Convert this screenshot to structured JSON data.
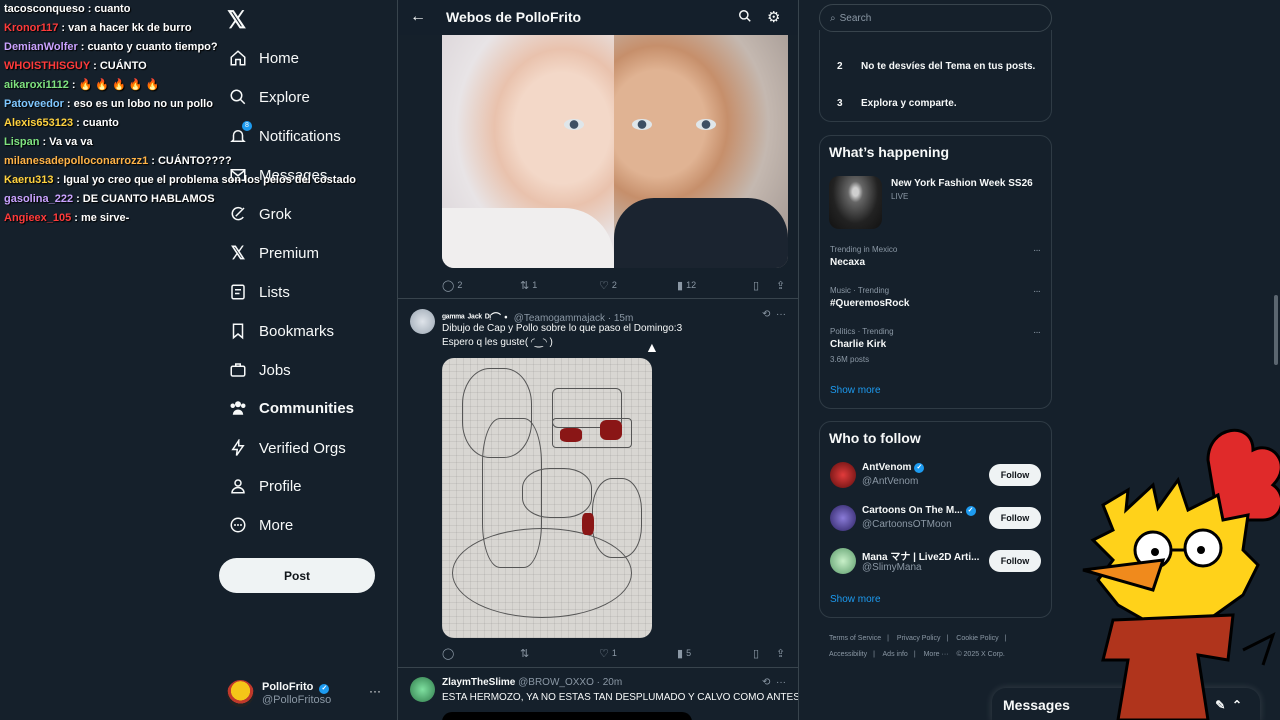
{
  "chat": {
    "messages": [
      {
        "user": "tacosconqueso",
        "color": "#ffffff",
        "text": "cuanto"
      },
      {
        "user": "Kronor117",
        "color": "#ff3b3b",
        "text": "van a hacer kk de burro"
      },
      {
        "user": "DemianWolfer",
        "color": "#c9a2ff",
        "text": "cuanto y cuanto tiempo?"
      },
      {
        "user": "WHOISTHISGUY",
        "color": "#ff3b3b",
        "text": "CUÁNTO"
      },
      {
        "user": "aikaroxi1112",
        "color": "#7fe37f",
        "text": "🔥 🔥 🔥 🔥 🔥"
      },
      {
        "user": "Patoveedor",
        "color": "#7fc7ff",
        "text": "eso es un lobo no un pollo"
      },
      {
        "user": "Alexis653123",
        "color": "#ffd23f",
        "text": "cuanto"
      },
      {
        "user": "Lispan",
        "color": "#7fe37f",
        "text": "Va va va"
      },
      {
        "user": "milanesadepolloconarrozz1",
        "color": "#ffb347",
        "text": "CUÁNTO????"
      },
      {
        "user": "Kaeru313",
        "color": "#ffd23f",
        "text": "Igual yo creo que el problema son los pelos del costado"
      },
      {
        "user": "gasolina_222",
        "color": "#c9a2ff",
        "text": "DE CUANTO HABLAMOS"
      },
      {
        "user": "Angieex_105",
        "color": "#ff3b3b",
        "text": "me sirve-"
      }
    ]
  },
  "nav": {
    "items": [
      {
        "label": "Home",
        "icon": "home-icon"
      },
      {
        "label": "Explore",
        "icon": "search-icon"
      },
      {
        "label": "Notifications",
        "icon": "bell-icon"
      },
      {
        "label": "Messages",
        "icon": "mail-icon"
      },
      {
        "label": "Grok",
        "icon": "grok-icon"
      },
      {
        "label": "Premium",
        "icon": "x-icon"
      },
      {
        "label": "Lists",
        "icon": "list-icon"
      },
      {
        "label": "Bookmarks",
        "icon": "bookmark-icon"
      },
      {
        "label": "Jobs",
        "icon": "briefcase-icon"
      },
      {
        "label": "Communities",
        "icon": "communities-icon"
      },
      {
        "label": "Verified Orgs",
        "icon": "lightning-icon"
      },
      {
        "label": "Profile",
        "icon": "person-icon"
      },
      {
        "label": "More",
        "icon": "more-circle-icon"
      }
    ],
    "notification_badge": "8",
    "post_label": "Post",
    "account": {
      "name": "PolloFrito",
      "handle": "@PolloFritoso"
    }
  },
  "main": {
    "title": "Webos de PolloFrito",
    "tweet1": {
      "replies": "2",
      "reposts": "1",
      "likes": "2",
      "views": "12"
    },
    "tweet2": {
      "name": "ᵍᵃᵐᵐᵃ ᴶᵃᶜᵏ ᴰᵎ⌒・",
      "handle": "@Teamogammajack",
      "time": "· 15m",
      "line1": "Dibujo de Cap y Pollo sobre lo que paso el Domingo:3",
      "line2": "Espero q les guste( ◜‿◝ )",
      "replies": "",
      "reposts": "",
      "likes": "1",
      "views": "5"
    },
    "tweet3": {
      "name": "ZlaymTheSlime",
      "handle": "@BROW_OXXO",
      "time": "· 20m",
      "line1": "ESTA HERMOZO, YA NO ESTAS TAN DESPLUMADO Y CALVO COMO ANTES"
    }
  },
  "right": {
    "search_placeholder": "Search",
    "rules": [
      {
        "num": "2",
        "text": "No te desvíes del Tema en tus posts."
      },
      {
        "num": "3",
        "text": "Explora y comparte."
      }
    ],
    "whats_happening": "What’s happening",
    "featured": {
      "title": "New York Fashion Week SS26",
      "status": "LIVE"
    },
    "trends": [
      {
        "category": "Trending in Mexico",
        "name": "Necaxa",
        "count": ""
      },
      {
        "category": "Music · Trending",
        "name": "#QueremosRock",
        "count": ""
      },
      {
        "category": "Politics · Trending",
        "name": "Charlie Kirk",
        "count": "3.6M posts"
      }
    ],
    "show_more": "Show more",
    "who_to_follow": "Who to follow",
    "follow_suggestions": [
      {
        "name": "AntVenom",
        "handle": "@AntVenom",
        "verified": true
      },
      {
        "name": "Cartoons On The M...",
        "handle": "@CartoonsOTMoon",
        "verified": true
      },
      {
        "name": "Mana マナ | Live2D Arti...",
        "handle": "@SlimyMana",
        "verified": false
      }
    ],
    "follow_label": "Follow",
    "footer": [
      "Terms of Service",
      "|",
      "Privacy Policy",
      "|",
      "Cookie Policy",
      "|",
      "Accessibility",
      "|",
      "Ads info",
      "|",
      "More ···",
      "© 2025 X Corp."
    ]
  },
  "messages_label": "Messages"
}
